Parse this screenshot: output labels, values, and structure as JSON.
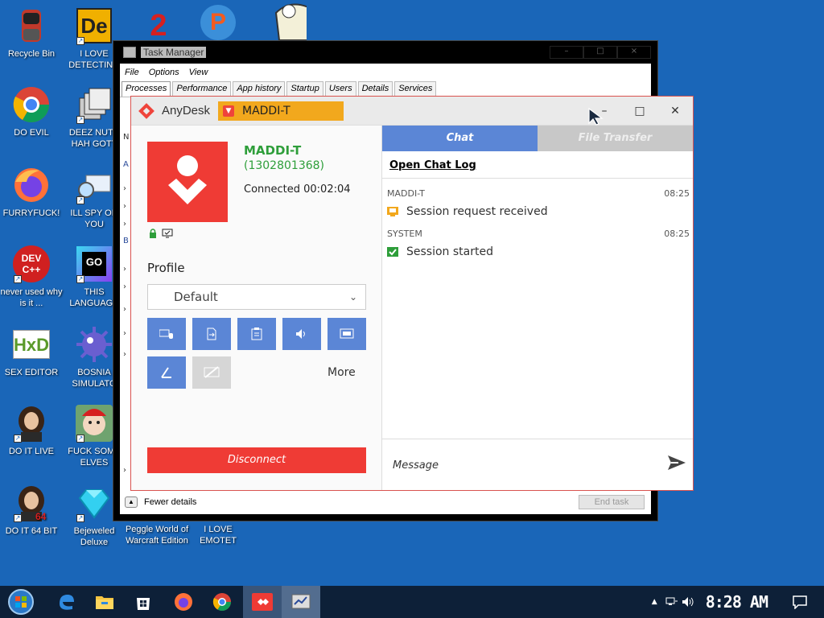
{
  "desktop": {
    "icons": [
      {
        "label": "Recycle Bin"
      },
      {
        "label": "I LOVE DETECTING"
      },
      {
        "label": "DO EVIL"
      },
      {
        "label": "DEEZ NUTS HAH GOTT"
      },
      {
        "label": "FURRYFUCK!"
      },
      {
        "label": "ILL SPY ON YOU"
      },
      {
        "label": "never used why is it ..."
      },
      {
        "label": "THIS LANGUAGE"
      },
      {
        "label": "SEX EDITOR"
      },
      {
        "label": "BOSNIA SIMULATO"
      },
      {
        "label": "DO IT LIVE"
      },
      {
        "label": "FUCK SOME ELVES"
      },
      {
        "label": "DO IT 64 BIT"
      },
      {
        "label": "Bejeweled Deluxe"
      },
      {
        "label": "Peggle World of Warcraft Edition"
      },
      {
        "label": "I LOVE EMOTET"
      }
    ],
    "icon_badges": {
      "devcpp": "DEV C++",
      "go": "GO",
      "hxd": "HxD",
      "de": "De",
      "p": "P",
      "two": "2"
    }
  },
  "task_manager": {
    "title": "Task Manager",
    "menu": [
      "File",
      "Options",
      "View"
    ],
    "tabs": [
      "Processes",
      "Performance",
      "App history",
      "Startup",
      "Users",
      "Details",
      "Services"
    ],
    "fewer_details": "Fewer details",
    "end_task": "End task",
    "side_label_n": "N",
    "side_label_a": "A",
    "side_label_b": "B",
    "side_arrow": "›"
  },
  "anydesk": {
    "app_name": "AnyDesk",
    "tab_label": "MADDI-T",
    "host_name": "MADDI-T",
    "host_id": "(1302801368)",
    "connected_text": "Connected 00:02:04",
    "profile_label": "Profile",
    "profile_value": "Default",
    "more_label": "More",
    "disconnect_label": "Disconnect",
    "chat_tab": "Chat",
    "file_transfer_tab": "File Transfer",
    "open_chat_log": "Open Chat Log",
    "messages": [
      {
        "sender": "MADDI-T",
        "time": "08:25",
        "text": "Session request received"
      },
      {
        "sender": "SYSTEM",
        "time": "08:25",
        "text": "Session started"
      }
    ],
    "message_placeholder": "Message",
    "colors": {
      "accent": "#ef3b35",
      "tab_blue": "#5b86d6",
      "tab_orange": "#f2a81d",
      "host_green": "#2e9e3a"
    }
  },
  "taskbar": {
    "clock": "8:28 AM",
    "tray_arrow": "▲"
  }
}
